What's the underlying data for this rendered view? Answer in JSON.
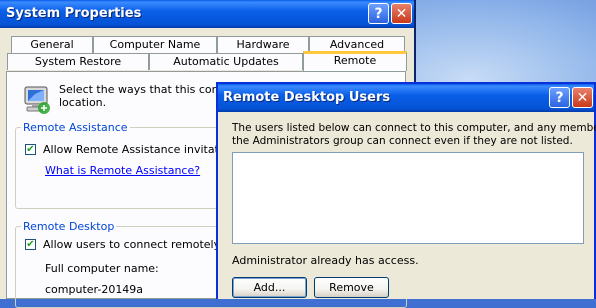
{
  "system_properties": {
    "title": "System Properties",
    "help_glyph": "?",
    "close_glyph": "✕",
    "tabs_row1": [
      "General",
      "Computer Name",
      "Hardware",
      "Advanced"
    ],
    "tabs_row2": [
      "System Restore",
      "Automatic Updates",
      "Remote"
    ],
    "active_tab": "Remote",
    "intro_line1": "Select the ways that this computer",
    "intro_line2": "location.",
    "remote_assistance": {
      "group_label": "Remote Assistance",
      "checkbox_label": "Allow Remote Assistance invitations",
      "checked": true,
      "link": "What is Remote Assistance?"
    },
    "remote_desktop": {
      "group_label": "Remote Desktop",
      "checkbox_label": "Allow users to connect remotely to th",
      "checked": true,
      "computer_name_label": "Full computer name:",
      "computer_name_value": "computer-20149a"
    },
    "check_mark": "✔"
  },
  "remote_desktop_users": {
    "title": "Remote Desktop Users",
    "help_glyph": "?",
    "close_glyph": "✕",
    "description_line1": "The users listed below can connect to this computer, and any members of",
    "description_line2": "the Administrators group can connect even if they are not listed.",
    "users": [],
    "access_note": "Administrator already has access.",
    "add_button": "Add...",
    "remove_button": "Remove"
  }
}
